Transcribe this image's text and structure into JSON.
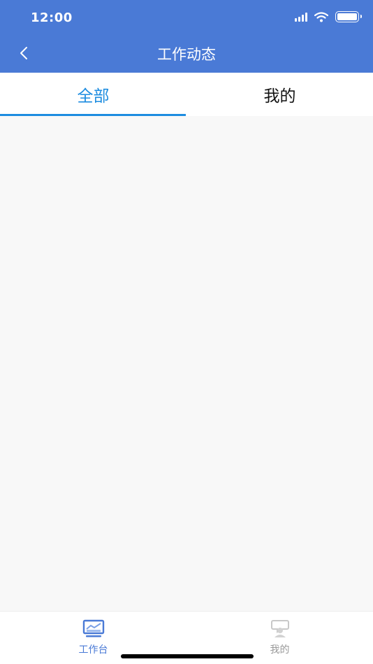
{
  "status_bar": {
    "time": "12:00"
  },
  "nav": {
    "title": "工作动态",
    "back_icon": "chevron-left-icon"
  },
  "tabs": [
    {
      "label": "全部",
      "active": true
    },
    {
      "label": "我的",
      "active": false
    }
  ],
  "bottom_tabs": [
    {
      "label": "工作台",
      "icon": "monitor-chart-icon",
      "active": true
    },
    {
      "label": "我的",
      "icon": "user-chat-icon",
      "active": false
    }
  ],
  "colors": {
    "header": "#4a7ad6",
    "tab_active": "#1d8ce0",
    "background": "#f8f8f8"
  }
}
